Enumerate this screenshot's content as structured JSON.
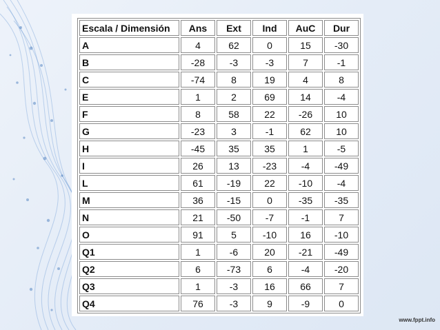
{
  "table": {
    "headers": [
      "Escala / Dimensión",
      "Ans",
      "Ext",
      "Ind",
      "AuC",
      "Dur"
    ],
    "rows": [
      [
        "A",
        "4",
        "62",
        "0",
        "15",
        "-30"
      ],
      [
        "B",
        "-28",
        "-3",
        "-3",
        "7",
        "-1"
      ],
      [
        "C",
        "-74",
        "8",
        "19",
        "4",
        "8"
      ],
      [
        "E",
        "1",
        "2",
        "69",
        "14",
        "-4"
      ],
      [
        "F",
        "8",
        "58",
        "22",
        "-26",
        "10"
      ],
      [
        "G",
        "-23",
        "3",
        "-1",
        "62",
        "10"
      ],
      [
        "H",
        "-45",
        "35",
        "35",
        "1",
        "-5"
      ],
      [
        "I",
        "26",
        "13",
        "-23",
        "-4",
        "-49"
      ],
      [
        "L",
        "61",
        "-19",
        "22",
        "-10",
        "-4"
      ],
      [
        "M",
        "36",
        "-15",
        "0",
        "-35",
        "-35"
      ],
      [
        "N",
        "21",
        "-50",
        "-7",
        "-1",
        "7"
      ],
      [
        "O",
        "91",
        "5",
        "-10",
        "16",
        "-10"
      ],
      [
        "Q1",
        "1",
        "-6",
        "20",
        "-21",
        "-49"
      ],
      [
        "Q2",
        "6",
        "-73",
        "6",
        "-4",
        "-20"
      ],
      [
        "Q3",
        "1",
        "-3",
        "16",
        "66",
        "7"
      ],
      [
        "Q4",
        "76",
        "-3",
        "9",
        "-9",
        "0"
      ]
    ]
  },
  "footer": {
    "credit": "www.fppt.info"
  },
  "colors": {
    "background": "#e4ecf7",
    "decor": "#4a7fc0",
    "table_border": "#8a8a8a"
  }
}
